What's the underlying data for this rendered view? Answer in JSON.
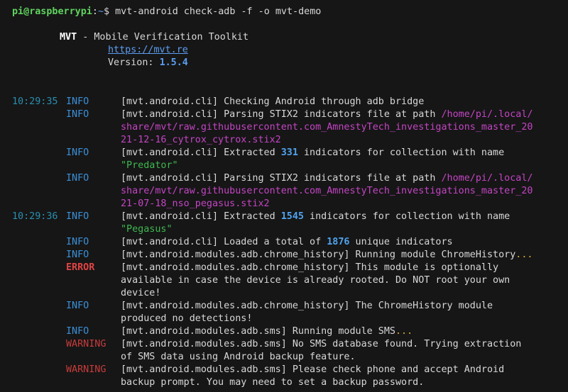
{
  "prompt": {
    "user": "pi",
    "host": "raspberrypi",
    "path": "~",
    "command": "mvt-android check-adb -f -o mvt-demo"
  },
  "banner": {
    "name": "MVT",
    "dash": " - Mobile Verification Toolkit",
    "url": "https://mvt.re",
    "version_label": "Version: ",
    "version": "1.5.4"
  },
  "log": [
    {
      "time": "10:29:35",
      "level": "INFO",
      "segments": [
        [
          "[mvt.android.cli] Checking Android through adb bridge",
          "n"
        ]
      ]
    },
    {
      "time": "",
      "level": "INFO",
      "segments": [
        [
          "[mvt.android.cli] Parsing STIX2 indicators file at path ",
          "n"
        ],
        [
          "/home/pi/.local/",
          "p"
        ]
      ]
    },
    {
      "time": "",
      "level": "",
      "segments": [
        [
          "share/mvt/raw.githubusercontent.com_AmnestyTech_investigations_master_20",
          "p"
        ]
      ]
    },
    {
      "time": "",
      "level": "",
      "segments": [
        [
          "21-12-16_cytrox_cytrox.stix2",
          "p"
        ]
      ]
    },
    {
      "time": "",
      "level": "INFO",
      "segments": [
        [
          "[mvt.android.cli] Extracted ",
          "n"
        ],
        [
          "331",
          "num"
        ],
        [
          " indicators for collection with name",
          "n"
        ]
      ]
    },
    {
      "time": "",
      "level": "",
      "segments": [
        [
          "\"Predator\"",
          "s"
        ]
      ]
    },
    {
      "time": "",
      "level": "INFO",
      "segments": [
        [
          "[mvt.android.cli] Parsing STIX2 indicators file at path ",
          "n"
        ],
        [
          "/home/pi/.local/",
          "p"
        ]
      ]
    },
    {
      "time": "",
      "level": "",
      "segments": [
        [
          "share/mvt/raw.githubusercontent.com_AmnestyTech_investigations_master_20",
          "p"
        ]
      ]
    },
    {
      "time": "",
      "level": "",
      "segments": [
        [
          "21-07-18_nso_pegasus.stix2",
          "p"
        ]
      ]
    },
    {
      "time": "10:29:36",
      "level": "INFO",
      "segments": [
        [
          "[mvt.android.cli] Extracted ",
          "n"
        ],
        [
          "1545",
          "num"
        ],
        [
          " indicators for collection with name",
          "n"
        ]
      ]
    },
    {
      "time": "",
      "level": "",
      "segments": [
        [
          "\"Pegasus\"",
          "s"
        ]
      ]
    },
    {
      "time": "",
      "level": "INFO",
      "segments": [
        [
          "[mvt.android.cli] Loaded a total of ",
          "n"
        ],
        [
          "1876",
          "num"
        ],
        [
          " unique indicators",
          "n"
        ]
      ]
    },
    {
      "time": "",
      "level": "INFO",
      "segments": [
        [
          "[mvt.android.modules.adb.chrome_history] Running module ChromeHistory",
          "n"
        ],
        [
          "...",
          "e"
        ]
      ]
    },
    {
      "time": "",
      "level": "ERROR",
      "segments": [
        [
          "[mvt.android.modules.adb.chrome_history] This module is optionally",
          "n"
        ]
      ]
    },
    {
      "time": "",
      "level": "",
      "segments": [
        [
          "available in case the device is already rooted. Do NOT root your own",
          "n"
        ]
      ]
    },
    {
      "time": "",
      "level": "",
      "segments": [
        [
          "device!",
          "n"
        ]
      ]
    },
    {
      "time": "",
      "level": "INFO",
      "segments": [
        [
          "[mvt.android.modules.adb.chrome_history] The ChromeHistory module",
          "n"
        ]
      ]
    },
    {
      "time": "",
      "level": "",
      "segments": [
        [
          "produced no detections!",
          "n"
        ]
      ]
    },
    {
      "time": "",
      "level": "INFO",
      "segments": [
        [
          "[mvt.android.modules.adb.sms] Running module SMS",
          "n"
        ],
        [
          "...",
          "e"
        ]
      ]
    },
    {
      "time": "",
      "level": "WARNING",
      "segments": [
        [
          "[mvt.android.modules.adb.sms] No SMS database found. Trying extraction",
          "n"
        ]
      ]
    },
    {
      "time": "",
      "level": "",
      "segments": [
        [
          "of SMS data using Android backup feature.",
          "n"
        ]
      ]
    },
    {
      "time": "",
      "level": "WARNING",
      "segments": [
        [
          "[mvt.android.modules.adb.sms] Please check phone and accept Android",
          "n"
        ]
      ]
    },
    {
      "time": "",
      "level": "",
      "segments": [
        [
          "backup prompt. You may need to set a backup password.",
          "n"
        ]
      ]
    }
  ]
}
